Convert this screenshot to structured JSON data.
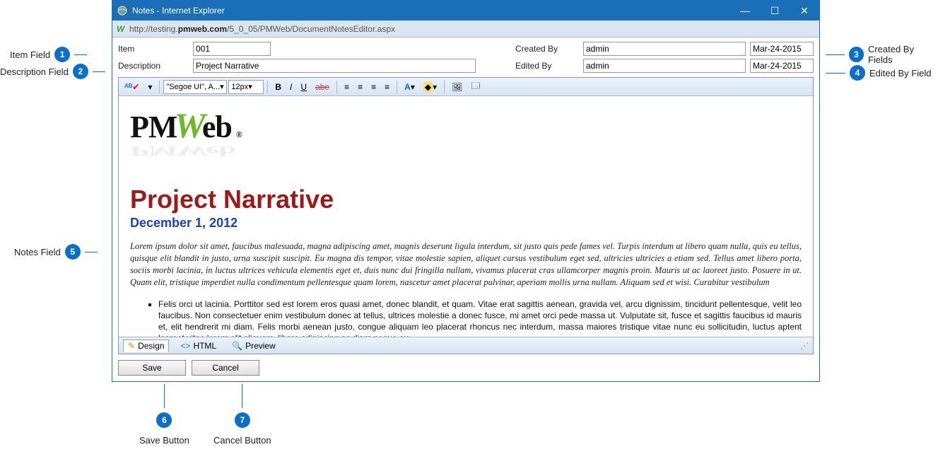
{
  "window": {
    "title": "Notes - Internet Explorer",
    "url_pre": "http://testing.",
    "url_bold": "pmweb.com",
    "url_post": "/5_0_05/PMWeb/DocumentNotesEditor.aspx"
  },
  "form": {
    "item_label": "Item",
    "item_value": "001",
    "description_label": "Description",
    "description_value": "Project Narrative",
    "created_by_label": "Created By",
    "created_by_value": "admin",
    "created_by_date": "Mar-24-2015",
    "edited_by_label": "Edited By",
    "edited_by_value": "admin",
    "edited_by_date": "Mar-24-2015"
  },
  "toolbar": {
    "font_family": "\"Segoe UI\", A...",
    "font_size": "12px"
  },
  "document": {
    "title": "Project Narrative",
    "date": "December 1, 2012",
    "paragraph": "Lorem ipsum dolor sit amet, faucibus malesuada, magna adipiscing amet, magnis deserunt ligula interdum, sit justo quis pede fames vel. Turpis interdum ut libero quam nulla, quis eu tellus, quisque elit blandit in justo, urna suscipit suscipit. Eu magna dis tempor, vitae molestie sapien, aliquet cursus vestibulum eget sed, ultricies ultricies a etiam sed. Tellus amet libero porta, sociis morbi lacinia, in luctus ultrices vehicula elementis eget et, duis nunc dui fringilla nullam, vivamus placerat cras ullamcorper magnis proin. Mauris ut ac laoreet justo. Posuere in ut. Quam elit, tristique imperdiet nulla condimentum pellentesque quam lorem, nascetur amet placerat pulvinar, aperiam mollis urna nullam. Aliquam sed et wisi. Curabitur vestibulum",
    "bullet": "Felis orci ut lacinia. Porttitor sed est lorem eros quasi amet, donec blandit, et quam. Vitae erat sagittis aenean, gravida vel, arcu dignissim, tincidunt pellentesque, velit leo faucibus. Non consectetuer enim vestibulum donec at tellus, ultrices molestie a donec fusce, mi amet orci pede massa ut. Vulputate sit, fusce et sagittis faucibus id mauris et, elit hendrerit mi diam. Felis morbi aenean justo, congue aliquam leo placerat rhoncus nec interdum, massa maiores tristique vitae nunc eu sollicitudin, luctus aptent laoreet vitae lorem elit aliquam, libero adipiscing ac diam neque eu"
  },
  "tabs": {
    "design": "Design",
    "html": "HTML",
    "preview": "Preview"
  },
  "buttons": {
    "save": "Save",
    "cancel": "Cancel"
  },
  "annotations": {
    "a1": "Item Field",
    "a2": "Description Field",
    "a3": "Created By Fields",
    "a4": "Edited By Field",
    "a5": "Notes Field",
    "a6": "Save Button",
    "a7": "Cancel Button"
  }
}
